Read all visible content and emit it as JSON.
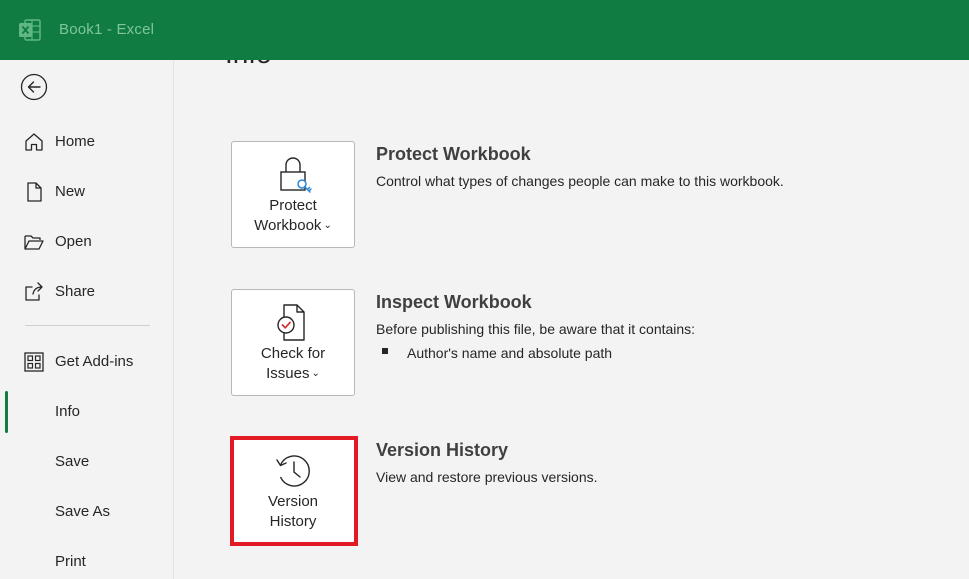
{
  "window": {
    "title": "Book1  -  Excel",
    "app_icon": "excel-icon",
    "accent_color": "#107c41"
  },
  "sidebar": {
    "back_icon": "back-arrow-icon",
    "items": [
      {
        "label": "Home",
        "icon": "home-icon"
      },
      {
        "label": "New",
        "icon": "new-document-icon"
      },
      {
        "label": "Open",
        "icon": "folder-open-icon"
      },
      {
        "label": "Share",
        "icon": "share-icon"
      },
      {
        "label": "Get Add-ins",
        "icon": "grid-icon"
      },
      {
        "label": "Info",
        "active": true
      },
      {
        "label": "Save"
      },
      {
        "label": "Save As"
      },
      {
        "label": "Print"
      }
    ]
  },
  "main": {
    "page_title": "Info",
    "sections": [
      {
        "button_line1": "Protect",
        "button_line2": "Workbook",
        "button_icon": "lock-key-icon",
        "has_dropdown": true,
        "title": "Protect Workbook",
        "description": "Control what types of changes people can make to this workbook."
      },
      {
        "button_line1": "Check for",
        "button_line2": "Issues",
        "button_icon": "check-document-icon",
        "has_dropdown": true,
        "title": "Inspect Workbook",
        "description": "Before publishing this file, be aware that it contains:",
        "bullets": [
          "Author's name and absolute path"
        ]
      },
      {
        "button_line1": "Version",
        "button_line2": "History",
        "button_icon": "history-clock-icon",
        "has_dropdown": false,
        "highlighted": true,
        "highlight_color": "#e11a24",
        "title": "Version History",
        "description": "View and restore previous versions."
      }
    ]
  }
}
